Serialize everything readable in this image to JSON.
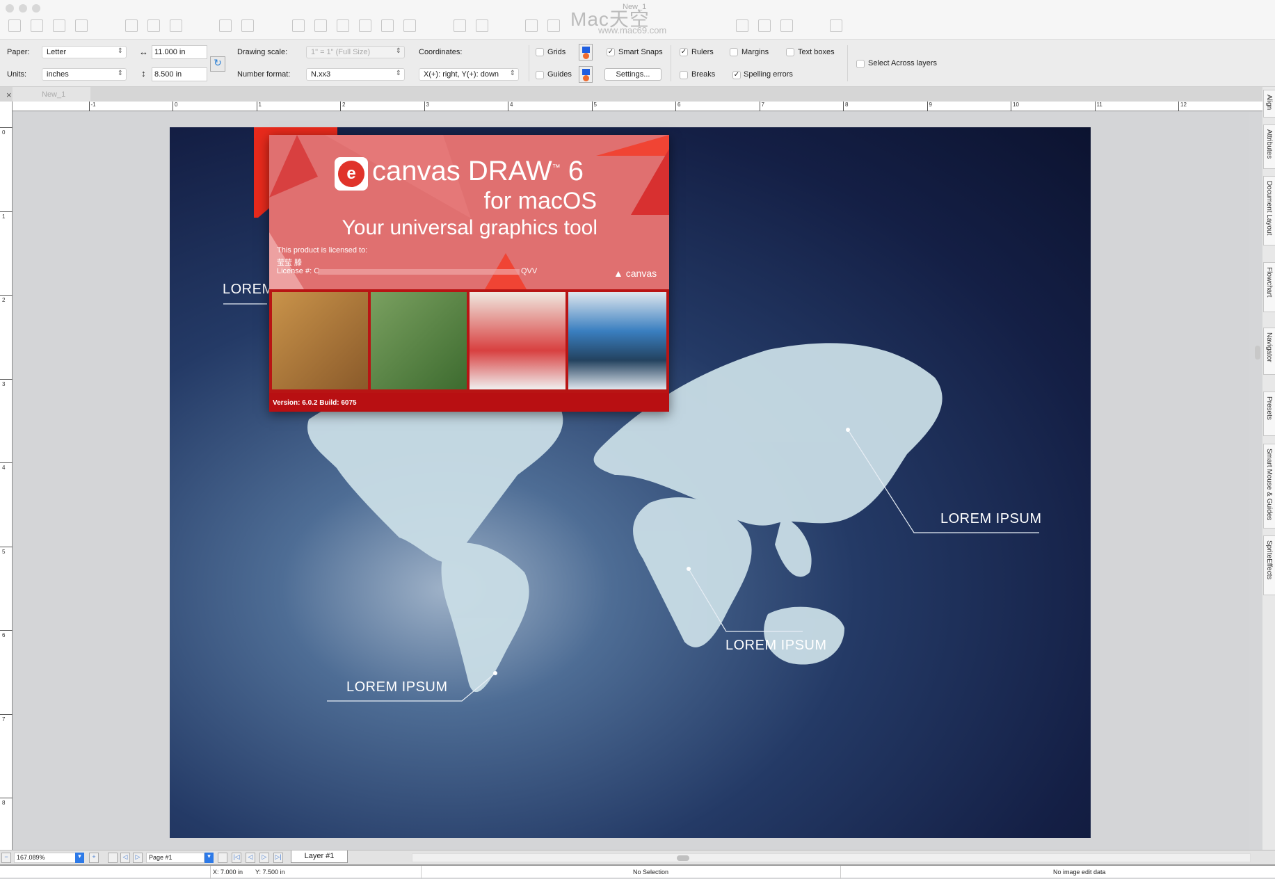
{
  "window": {
    "title": "New_1",
    "watermark": "Mac天空",
    "watermark_url": "www.mac69.com"
  },
  "options": {
    "paper_label": "Paper:",
    "paper_value": "Letter",
    "units_label": "Units:",
    "units_value": "inches",
    "width_value": "11.000 in",
    "height_value": "8.500 in",
    "drawing_scale_label": "Drawing scale:",
    "drawing_scale_value": "1\" = 1\"  (Full Size)",
    "number_format_label": "Number format:",
    "number_format_value": "N.xx3",
    "coordinates_label": "Coordinates:",
    "coordinates_value": "X(+): right, Y(+): down",
    "checkboxes": [
      {
        "label": "Grids",
        "checked": false
      },
      {
        "label": "Guides",
        "checked": false
      },
      {
        "label": "Smart Snaps",
        "checked": true
      },
      {
        "label": "Rulers",
        "checked": true
      },
      {
        "label": "Breaks",
        "checked": false
      },
      {
        "label": "Margins",
        "checked": false
      },
      {
        "label": "Spelling errors",
        "checked": true
      },
      {
        "label": "Text boxes",
        "checked": false
      },
      {
        "label": "Select Across layers",
        "checked": false
      }
    ],
    "settings_button": "Settings..."
  },
  "tabs": {
    "close": "×",
    "doc": "New_1"
  },
  "ruler": {
    "top": [
      "-1",
      "0",
      "1",
      "2",
      "3",
      "4",
      "5",
      "6",
      "7",
      "8",
      "9",
      "10",
      "11",
      "12",
      "1"
    ],
    "left": [
      "0",
      "1",
      "2",
      "3",
      "4",
      "5",
      "6",
      "7",
      "8"
    ]
  },
  "page": {
    "labels": [
      "LOREM IPSUM",
      "LOREM IPSUM",
      "LOREM IPSUM",
      "LOREM"
    ]
  },
  "splash": {
    "brand": "canvas DRAW",
    "tm": "™",
    "version_num": "6",
    "platform": "for macOS",
    "tagline": "Your universal graphics tool",
    "licensed_to": "This product is licensed to:",
    "licensee": "莹莹 滕",
    "license": "License #: C",
    "license_tail": "QVV",
    "logo_text": "canvas",
    "version": "Version: 6.0.2 Build: 6075"
  },
  "right_panel": [
    "Align",
    "Attributes",
    "Document Layout",
    "Flowchart",
    "Navigator",
    "Presets",
    "Smart Mouse & Guides",
    "SpriteEffects"
  ],
  "bottom": {
    "zoom": "167.089%",
    "page": "Page #1",
    "layer": "Layer #1"
  },
  "status": {
    "x": "X: 7.000 in",
    "y": "Y: 7.500 in",
    "selection": "No Selection",
    "image": "No image edit data"
  },
  "colors": {
    "splash_red": "#e07070",
    "brand_red": "#b80f12",
    "map": "#c9dde6",
    "accent_blue": "#1f5ee0"
  }
}
